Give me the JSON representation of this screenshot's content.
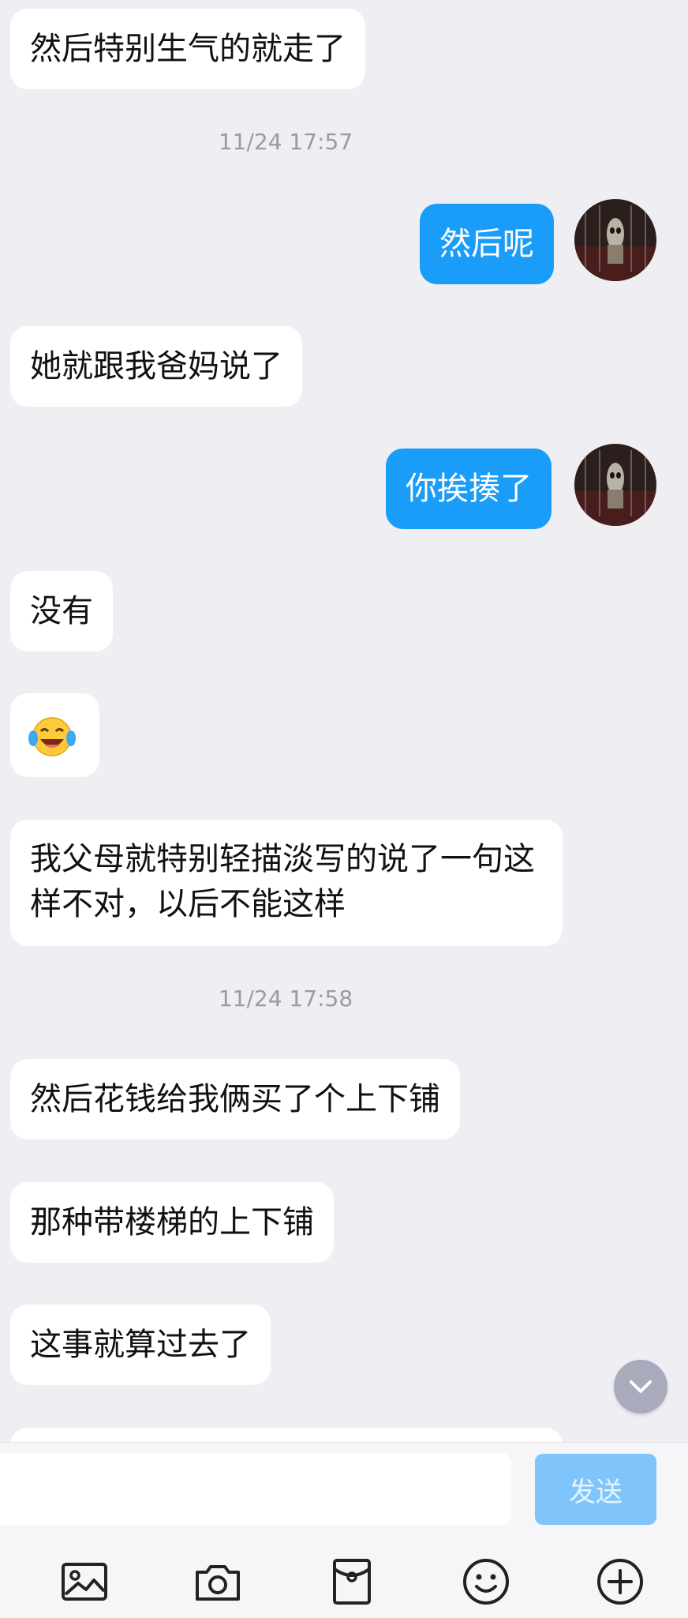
{
  "messages": [
    {
      "text": "然后特别生气的就走了"
    },
    {
      "text": "然后呢"
    },
    {
      "text": "她就跟我爸妈说了"
    },
    {
      "text": "你挨揍了"
    },
    {
      "text": "没有"
    },
    {
      "emoji": "tears-of-joy"
    },
    {
      "text": "我父母就特别轻描淡写的说了一句这样不对，以后不能这样"
    },
    {
      "text": "然后花钱给我俩买了个上下铺"
    },
    {
      "text": "那种带楼梯的上下铺"
    },
    {
      "text": "这事就算过去了"
    }
  ],
  "timestamps": [
    "11/24 17:57",
    "11/24 17:58"
  ],
  "input": {
    "value": "",
    "send_label": "发送"
  },
  "toolbar": [
    "image-icon",
    "camera-icon",
    "red-packet-icon",
    "emoji-icon",
    "plus-icon"
  ],
  "colors": {
    "outgoing_bubble": "#1a9cf9",
    "background": "#eeeef3",
    "send_disabled": "#7fc5fb"
  }
}
